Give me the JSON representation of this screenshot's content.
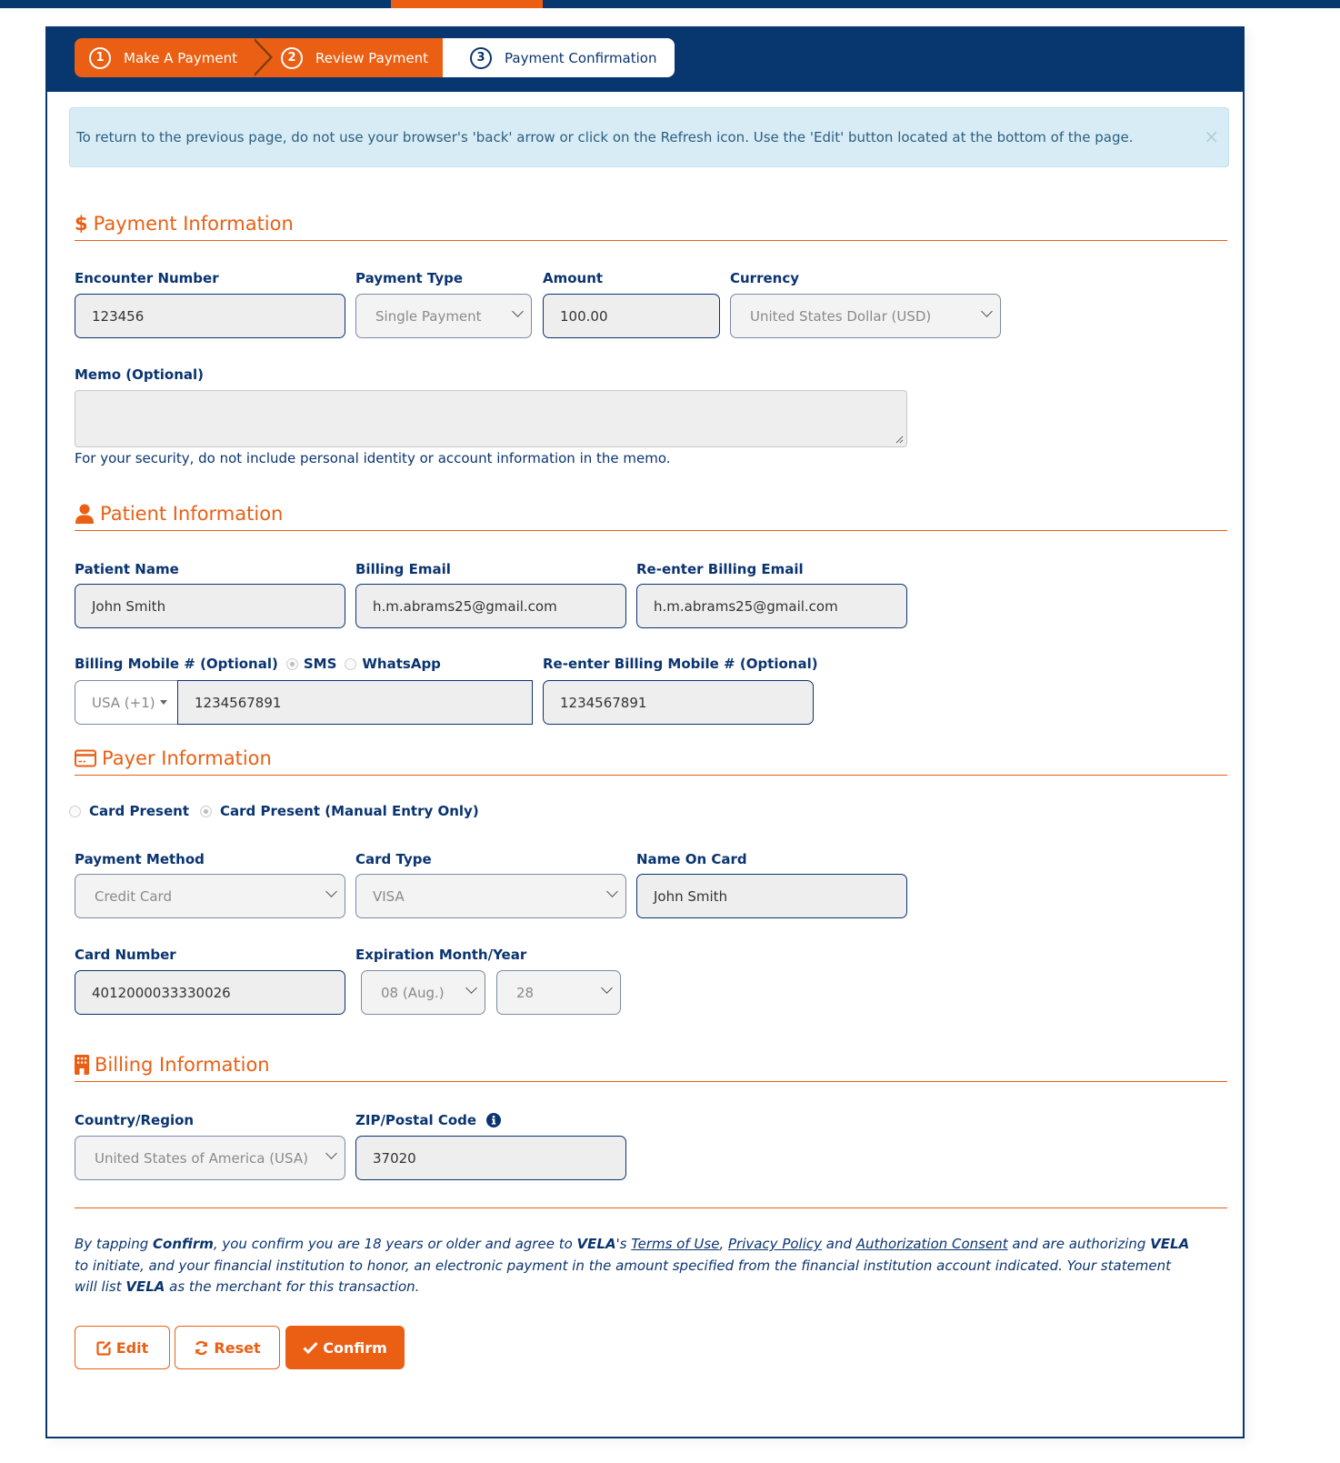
{
  "stepper": {
    "steps": [
      {
        "num": "1",
        "label": "Make A Payment",
        "state": "done"
      },
      {
        "num": "2",
        "label": "Review Payment",
        "state": "done"
      },
      {
        "num": "3",
        "label": "Payment Confirmation",
        "state": "current"
      }
    ]
  },
  "alert": {
    "text": "To return to the previous page, do not use your browser's 'back' arrow or click on the Refresh icon. Use the 'Edit' button located at the bottom of the page.",
    "close": "×"
  },
  "payment_info": {
    "title": "Payment Information",
    "icon": "dollar-icon",
    "encounter_number": {
      "label": "Encounter Number",
      "value": "123456"
    },
    "payment_type": {
      "label": "Payment Type",
      "value": "Single Payment"
    },
    "amount": {
      "label": "Amount",
      "value": "100.00"
    },
    "currency": {
      "label": "Currency",
      "value": "United States Dollar (USD)"
    },
    "memo": {
      "label": "Memo (Optional)",
      "value": "",
      "help": "For your security, do not include personal identity or account information in the memo."
    }
  },
  "patient_info": {
    "title": "Patient Information",
    "icon": "user-icon",
    "patient_name": {
      "label": "Patient Name",
      "value": "John Smith"
    },
    "billing_email": {
      "label": "Billing Email",
      "value": "h.m.abrams25@gmail.com"
    },
    "reenter_email": {
      "label": "Re-enter Billing Email",
      "value": "h.m.abrams25@gmail.com"
    },
    "billing_mobile": {
      "label": "Billing Mobile # (Optional)",
      "sms_label": "SMS",
      "whatsapp_label": "WhatsApp",
      "country_code": "USA (+1)",
      "value": "1234567891",
      "selected_channel": "SMS"
    },
    "reenter_mobile": {
      "label": "Re-enter Billing Mobile # (Optional)",
      "value": "1234567891"
    }
  },
  "payer_info": {
    "title": "Payer Information",
    "icon": "credit-card-icon",
    "entry_options": [
      "Card Present",
      "Card Present (Manual Entry Only)"
    ],
    "selected_entry": "Card Present (Manual Entry Only)",
    "payment_method": {
      "label": "Payment Method",
      "value": "Credit Card"
    },
    "card_type": {
      "label": "Card Type",
      "value": "VISA"
    },
    "name_on_card": {
      "label": "Name On Card",
      "value": "John Smith"
    },
    "card_number": {
      "label": "Card Number",
      "value": "4012000033330026"
    },
    "expiration": {
      "label": "Expiration Month/Year",
      "month": "08 (Aug.)",
      "year": "28"
    }
  },
  "billing_info": {
    "title": "Billing Information",
    "icon": "building-icon",
    "country": {
      "label": "Country/Region",
      "value": "United States of America (USA)"
    },
    "zip": {
      "label": "ZIP/Postal Code",
      "value": "37020",
      "info_icon": "info-circle-icon"
    }
  },
  "terms": {
    "p1": "By tapping ",
    "confirm_word": "Confirm",
    "p2": ", you confirm you are 18 years or older and agree to ",
    "vela1": "VELA",
    "p3": "'s ",
    "terms_link": "Terms of Use",
    "sep1": ", ",
    "privacy_link": "Privacy Policy",
    "sep2": " and ",
    "auth_link": "Authorization Consent",
    "p4": " and are authorizing ",
    "vela2": "VELA",
    "p5": " to initiate, and your financial institution to honor, an electronic payment in the amount specified from the financial institution account indicated. Your statement will list ",
    "vela3": "VELA",
    "p6": " as the merchant for this transaction."
  },
  "actions": {
    "edit_label": "Edit",
    "reset_label": "Reset",
    "confirm_label": "Confirm"
  },
  "colors": {
    "brand_navy": "#083770",
    "accent_orange": "#ea5f13",
    "alert_bg": "#d8ecf6"
  }
}
